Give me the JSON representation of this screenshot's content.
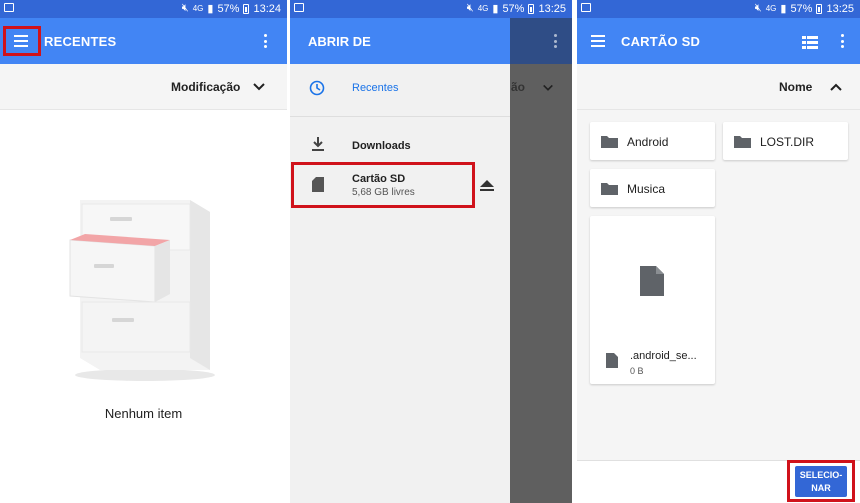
{
  "status_bars": [
    {
      "battery": "57%",
      "time": "13:24",
      "signal": "4G"
    },
    {
      "battery": "57%",
      "time": "13:25",
      "signal": "4G"
    },
    {
      "battery": "57%",
      "time": "13:25",
      "signal": "4G"
    }
  ],
  "screen1": {
    "title": "RECENTES",
    "sort_label": "Modificação",
    "empty_message": "Nenhum item"
  },
  "screen2": {
    "title": "ABRIR DE",
    "background_sort_label": "ão",
    "items": [
      {
        "label": "Recentes",
        "icon": "clock-icon",
        "color": "#1a73e8"
      },
      {
        "label": "Downloads",
        "icon": "download-icon"
      },
      {
        "label": "Cartão SD",
        "sublabel": "5,68 GB livres",
        "icon": "sd-card-icon"
      }
    ]
  },
  "screen3": {
    "title": "CARTÃO SD",
    "sort_label": "Nome",
    "folders": [
      "Android",
      "LOST.DIR",
      "Musica"
    ],
    "file": {
      "name": ".android_se...",
      "size": "0 B"
    },
    "select_button": "SELECIONAR",
    "select_button_lines": [
      "SELECIO-",
      "NAR"
    ]
  },
  "colors": {
    "app_bar": "#4285f4",
    "status_bar": "#3367d6",
    "highlight": "#d0121b",
    "accent": "#1a73e8"
  }
}
